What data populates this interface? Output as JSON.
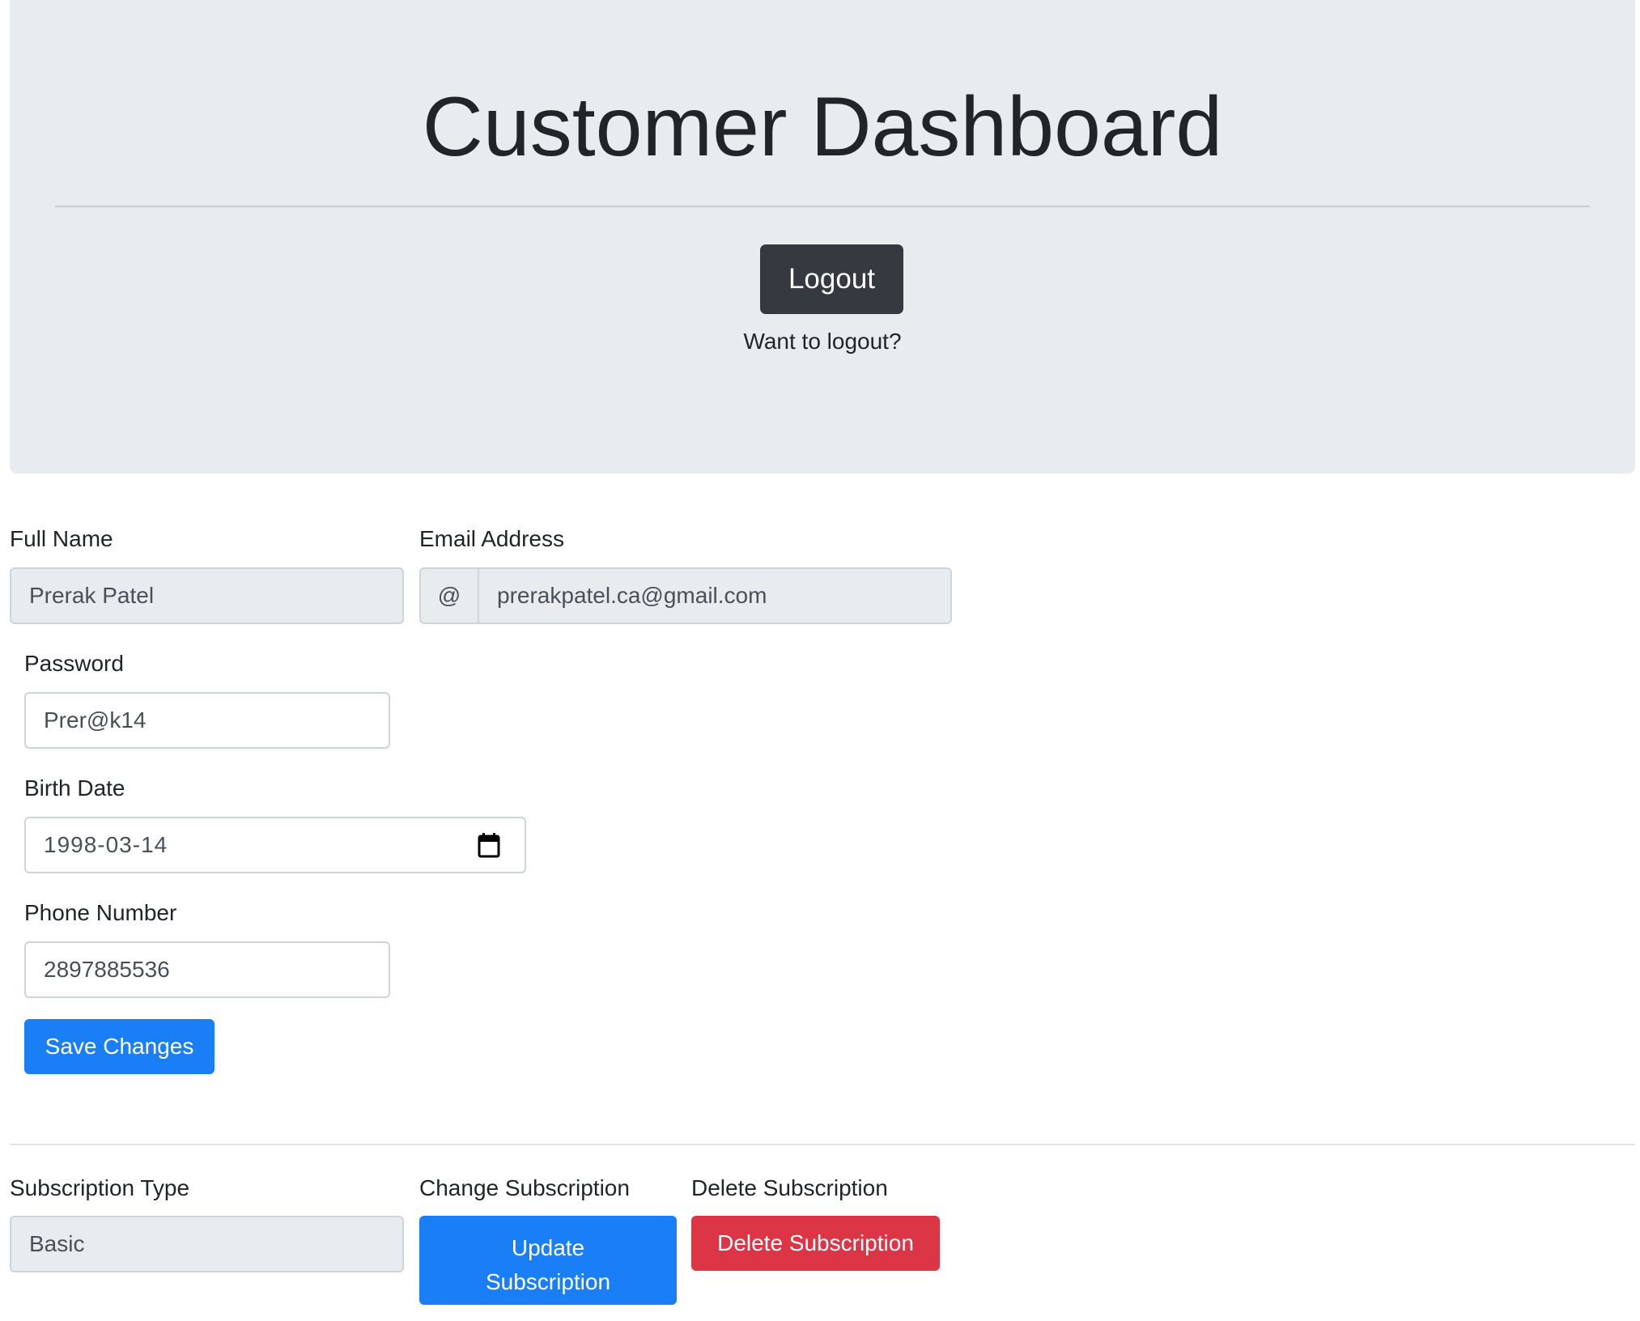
{
  "header": {
    "title": "Customer Dashboard",
    "logout_label": "Logout",
    "logout_hint": "Want to logout?"
  },
  "profile_form": {
    "full_name_label": "Full Name",
    "full_name_value": "Prerak Patel",
    "email_label": "Email Address",
    "email_prefix": "@",
    "email_value": "prerakpatel.ca@gmail.com",
    "password_label": "Password",
    "password_value": "Prer@k14",
    "birth_date_label": "Birth Date",
    "birth_date_value": "1998-03-14",
    "phone_label": "Phone Number",
    "phone_value": "2897885536",
    "save_label": "Save Changes"
  },
  "subscription": {
    "type_label": "Subscription Type",
    "type_value": "Basic",
    "change_label": "Change Subscription",
    "update_button_line1": "Update",
    "update_button_line2": "Subscription",
    "delete_label": "Delete Subscription",
    "delete_button_label": "Delete Subscription"
  },
  "colors": {
    "jumbotron_bg": "#e9ecef",
    "primary": "#1a7ff7",
    "danger": "#dc3545",
    "dark": "#343a40"
  },
  "icons": {
    "birth_date_picker": "calendar-icon"
  }
}
